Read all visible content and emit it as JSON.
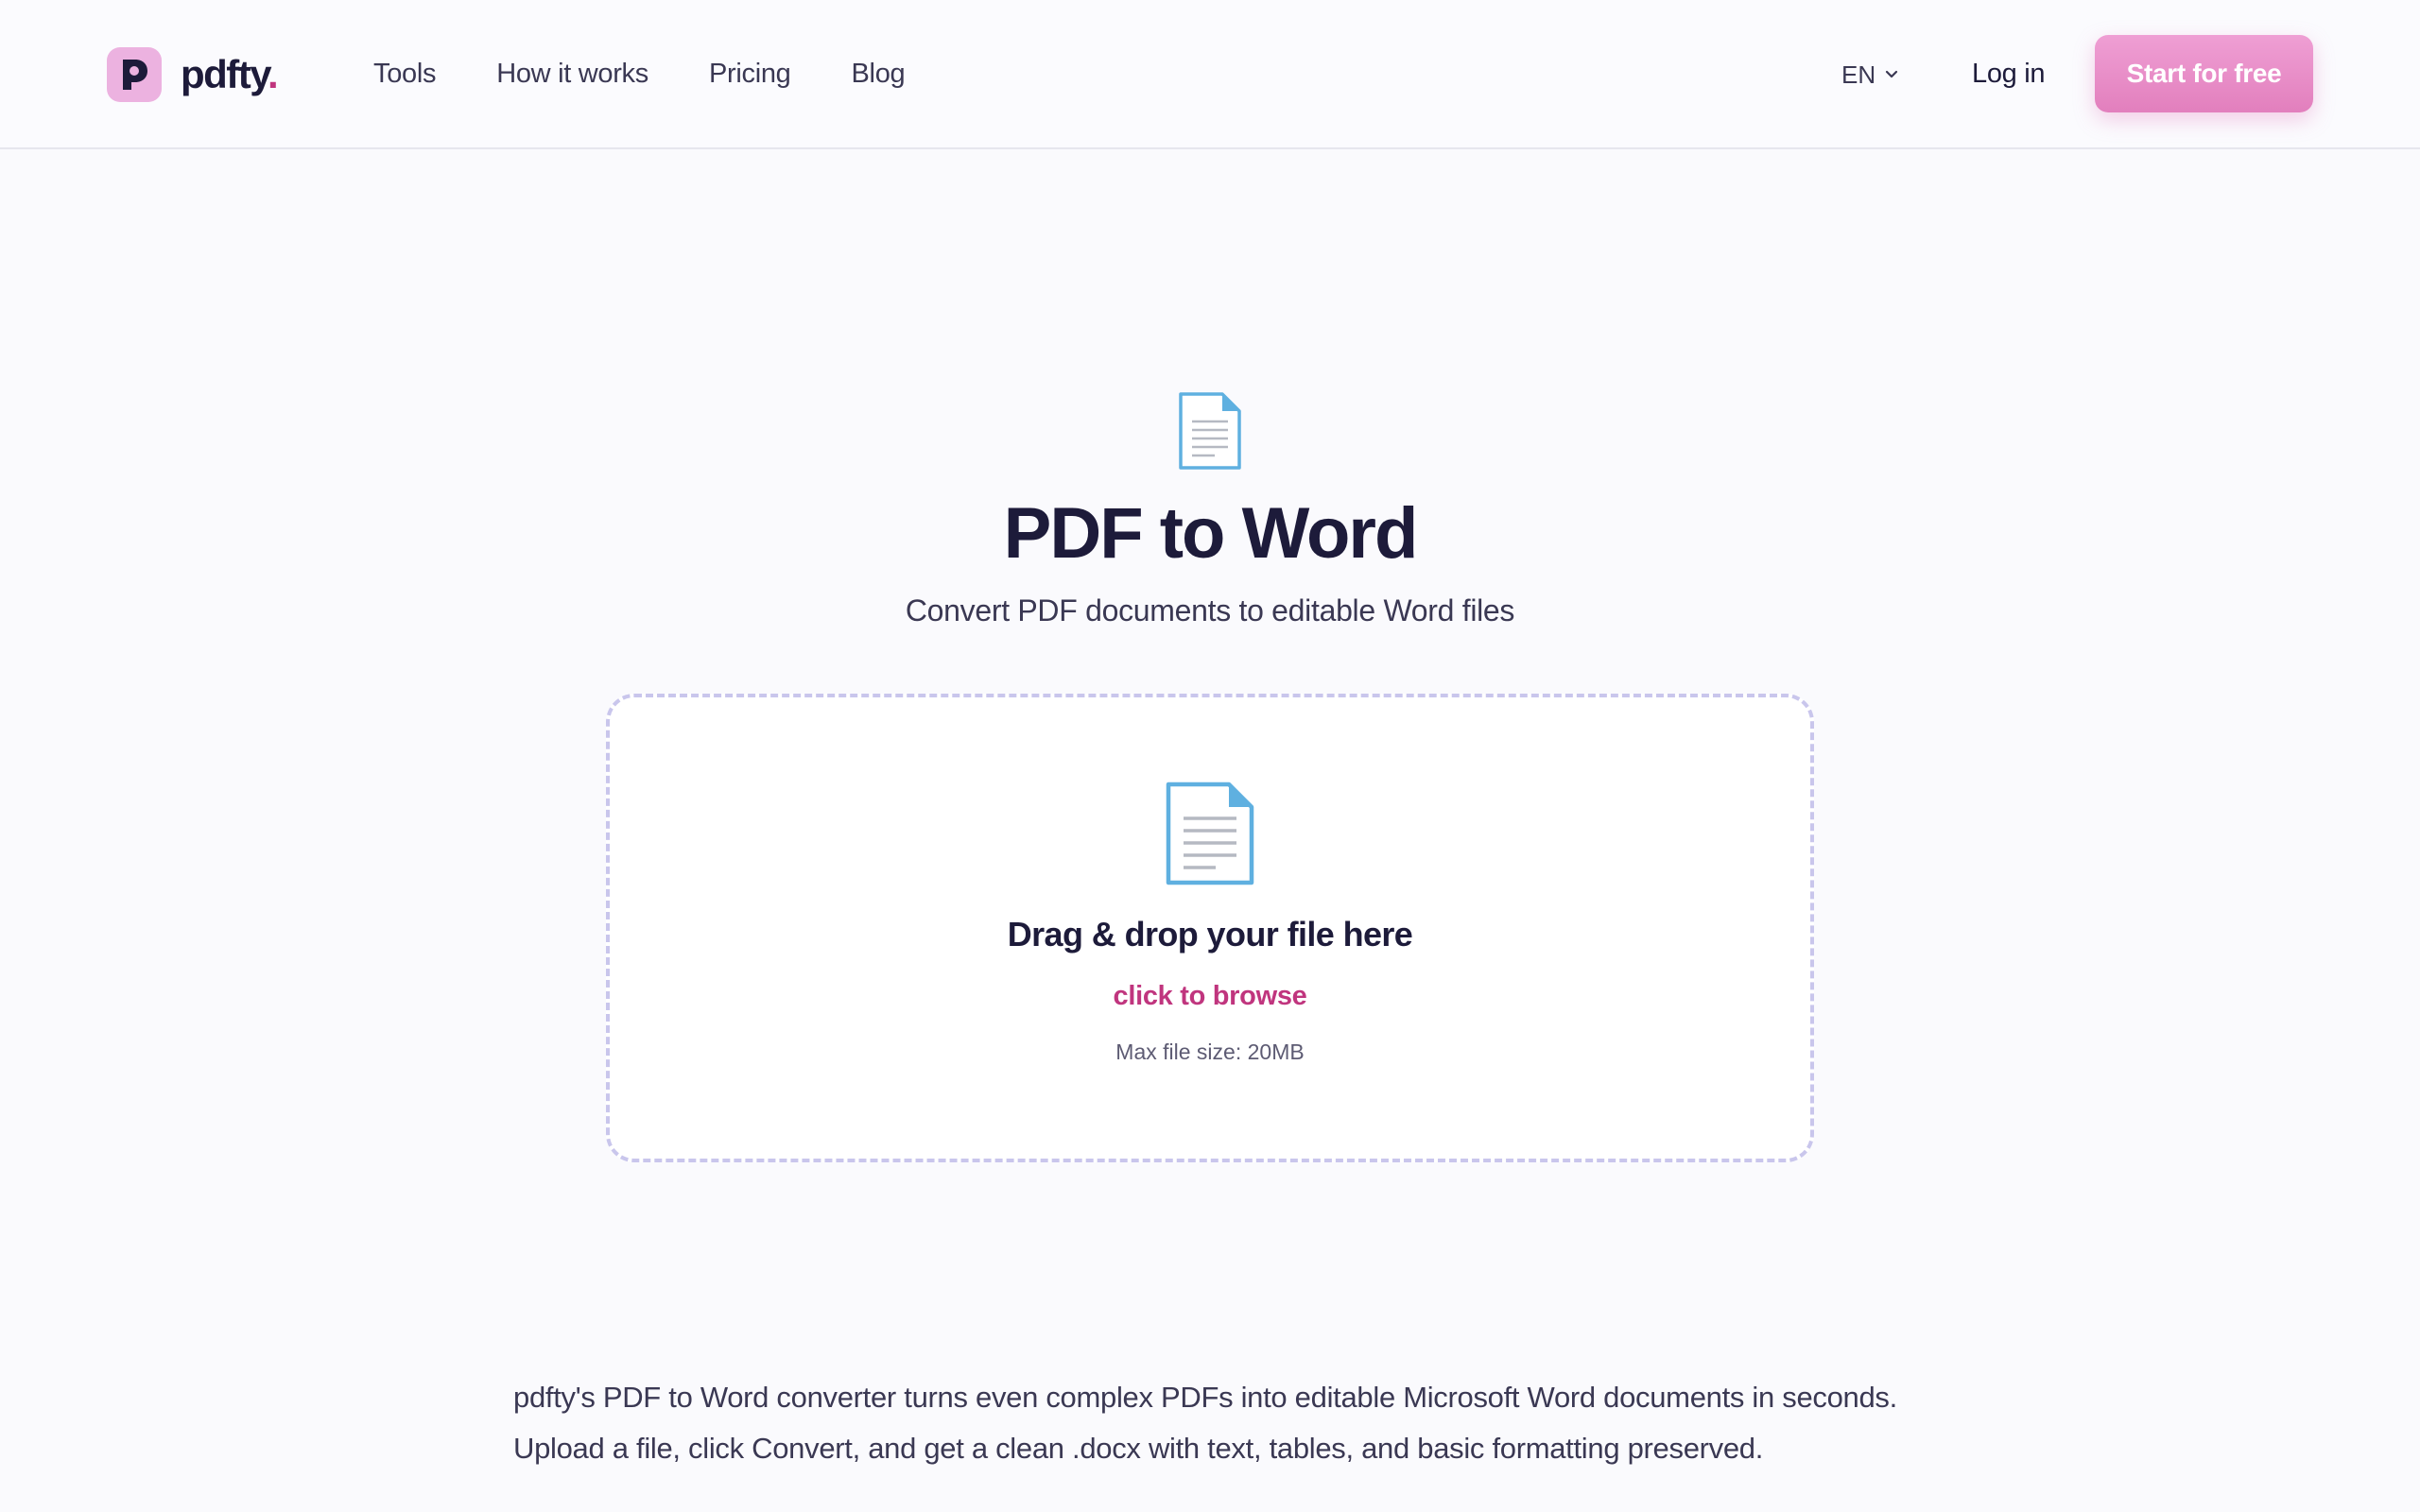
{
  "brand": {
    "name": "pdfty",
    "dot": "."
  },
  "nav": {
    "items": [
      {
        "label": "Tools"
      },
      {
        "label": "How it works"
      },
      {
        "label": "Pricing"
      },
      {
        "label": "Blog"
      }
    ]
  },
  "header": {
    "language": "EN",
    "login_label": "Log in",
    "cta_label": "Start for free"
  },
  "hero": {
    "icon": "document-icon",
    "title": "PDF to Word",
    "subtitle": "Convert PDF documents to editable Word files"
  },
  "dropzone": {
    "icon": "document-icon",
    "title": "Drag & drop your file here",
    "browse_label": "click to browse",
    "max_size": "Max file size: 20MB"
  },
  "description": {
    "lines": [
      "pdfty's PDF to Word converter turns even complex PDFs into editable Microsoft Word documents in seconds.",
      "Upload a file, click Convert, and get a clean .docx with text, tables, and basic formatting preserved."
    ]
  },
  "colors": {
    "accent": "#c0357e",
    "cta_gradient_top": "#ef9fd4",
    "cta_gradient_bottom": "#e27fbd",
    "logo_mark": "#ecb2e0",
    "dropzone_border": "#c9c6ec",
    "text_dark": "#1d1b3a",
    "icon_blue": "#5fb0e0"
  }
}
